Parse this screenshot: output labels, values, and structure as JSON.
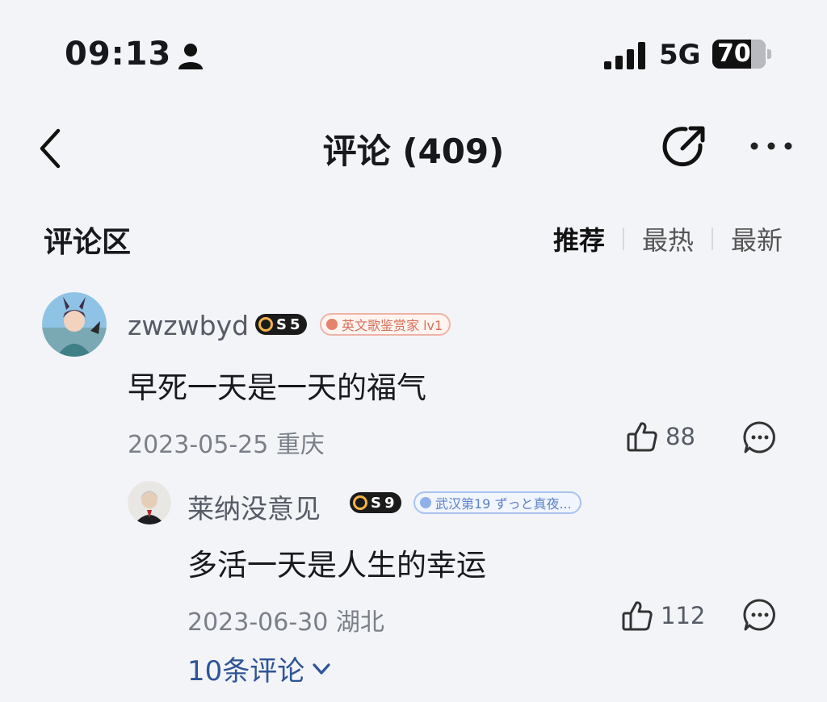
{
  "status_bar": {
    "time": "09:13",
    "network": "5G",
    "battery": "70",
    "icons": [
      "person-icon",
      "signal-icon"
    ]
  },
  "nav": {
    "title": "评论 (409)",
    "icons": [
      "back-icon",
      "share-icon",
      "more-icon"
    ]
  },
  "section": {
    "title": "评论区",
    "sort_tabs": [
      "推荐",
      "最热",
      "最新"
    ],
    "active_tab": "推荐"
  },
  "comments": [
    {
      "username": "zwzwbyd",
      "level": "5",
      "badge": "英文歌鉴赏家 lv1",
      "text": "早死一天是一天的福气",
      "date": "2023-05-25 重庆",
      "likes": "88",
      "replies": [
        {
          "username": "莱纳没意见",
          "level": "9",
          "badge": "武汉第19 ずっと真夜...",
          "text": "多活一天是人生的幸运",
          "date": "2023-06-30 湖北",
          "likes": "112"
        }
      ],
      "more_replies": "10条评论"
    }
  ],
  "colors": {
    "background": "#f3f4f8",
    "link": "#2f5597",
    "badge_orange": "#d86f5a",
    "badge_blue": "#5c80c8"
  }
}
